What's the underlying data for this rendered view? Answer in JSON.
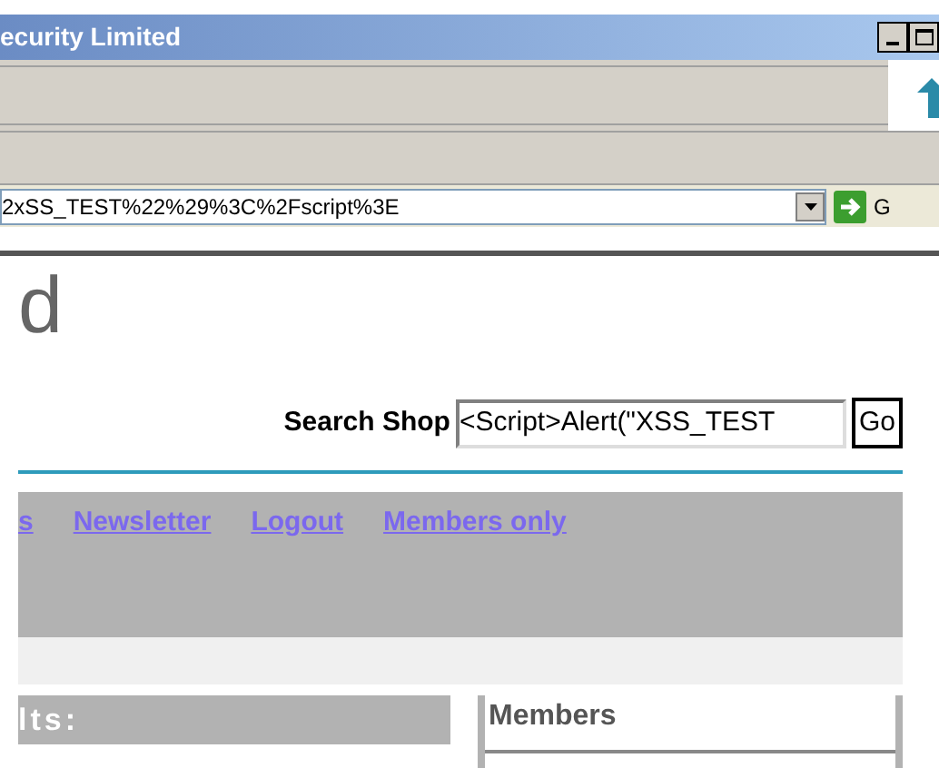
{
  "window": {
    "title": "ecurity Limited"
  },
  "address_bar": {
    "value": "2xSS_TEST%22%29%3C%2Fscript%3E",
    "go_label": "G"
  },
  "page": {
    "logo_fragment": "d",
    "search": {
      "label": "Search Shop",
      "value": "<Script>Alert(\"XSS_TEST",
      "button": "Go"
    },
    "nav_links": [
      "s",
      "Newsletter",
      "Logout",
      "Members only"
    ],
    "results_heading": "lts:",
    "members_heading": "Members"
  }
}
